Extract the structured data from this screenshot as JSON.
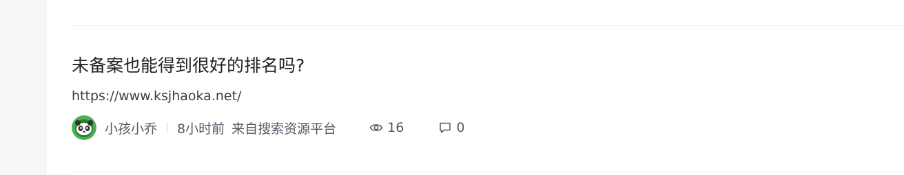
{
  "post": {
    "title": "未备案也能得到很好的排名吗?",
    "excerpt": "https://www.ksjhaoka.net/",
    "author": "小孩小乔",
    "time": "8小时前",
    "source": "来自搜索资源平台",
    "views": "16",
    "comments": "0"
  },
  "icons": {
    "avatar": "panda-avatar-icon",
    "views": "eye-icon",
    "comments": "comment-icon"
  },
  "colors": {
    "title": "#222226",
    "meta": "#555666",
    "rail": "#f5f6f8",
    "avatar_ring": "#4caf50"
  }
}
